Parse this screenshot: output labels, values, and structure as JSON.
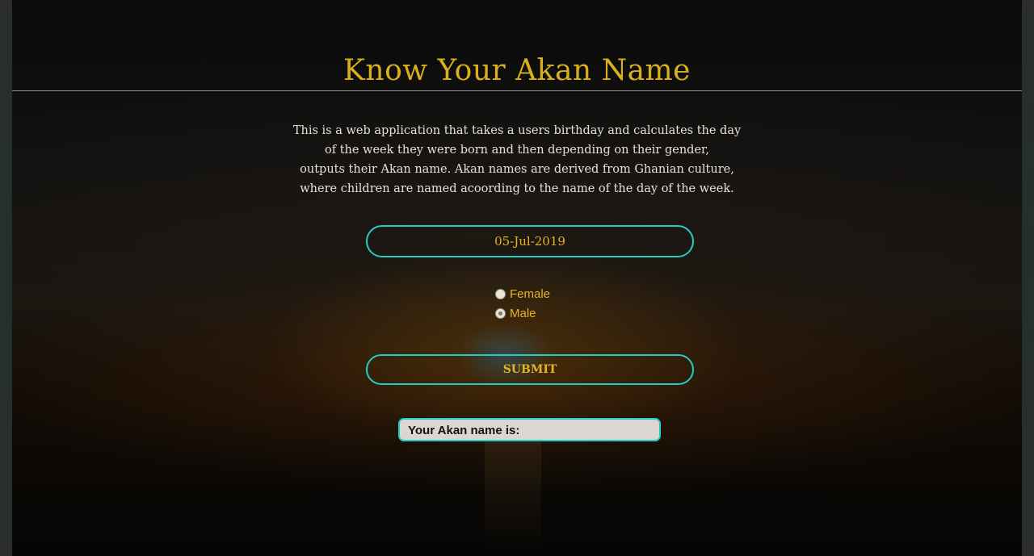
{
  "header": {
    "title": "Know Your Akan Name"
  },
  "description": {
    "line1": "This is a web application that takes a users birthday and calculates the day",
    "line2": "of the week they were born and then depending on their gender,",
    "line3": "outputs their Akan name. Akan names are derived from Ghanian culture,",
    "line4": "where children are named acoording to the name of the day of the week."
  },
  "form": {
    "birthday_value": "05-Jul-2019",
    "gender_options": [
      {
        "label": "Female",
        "checked": false
      },
      {
        "label": "Male",
        "checked": true
      }
    ],
    "submit_label": "SUBMIT",
    "result_label": "Your Akan name is:"
  },
  "colors": {
    "accent": "#1fd0c2",
    "title": "#d9b01c",
    "label": "#e3b526"
  }
}
